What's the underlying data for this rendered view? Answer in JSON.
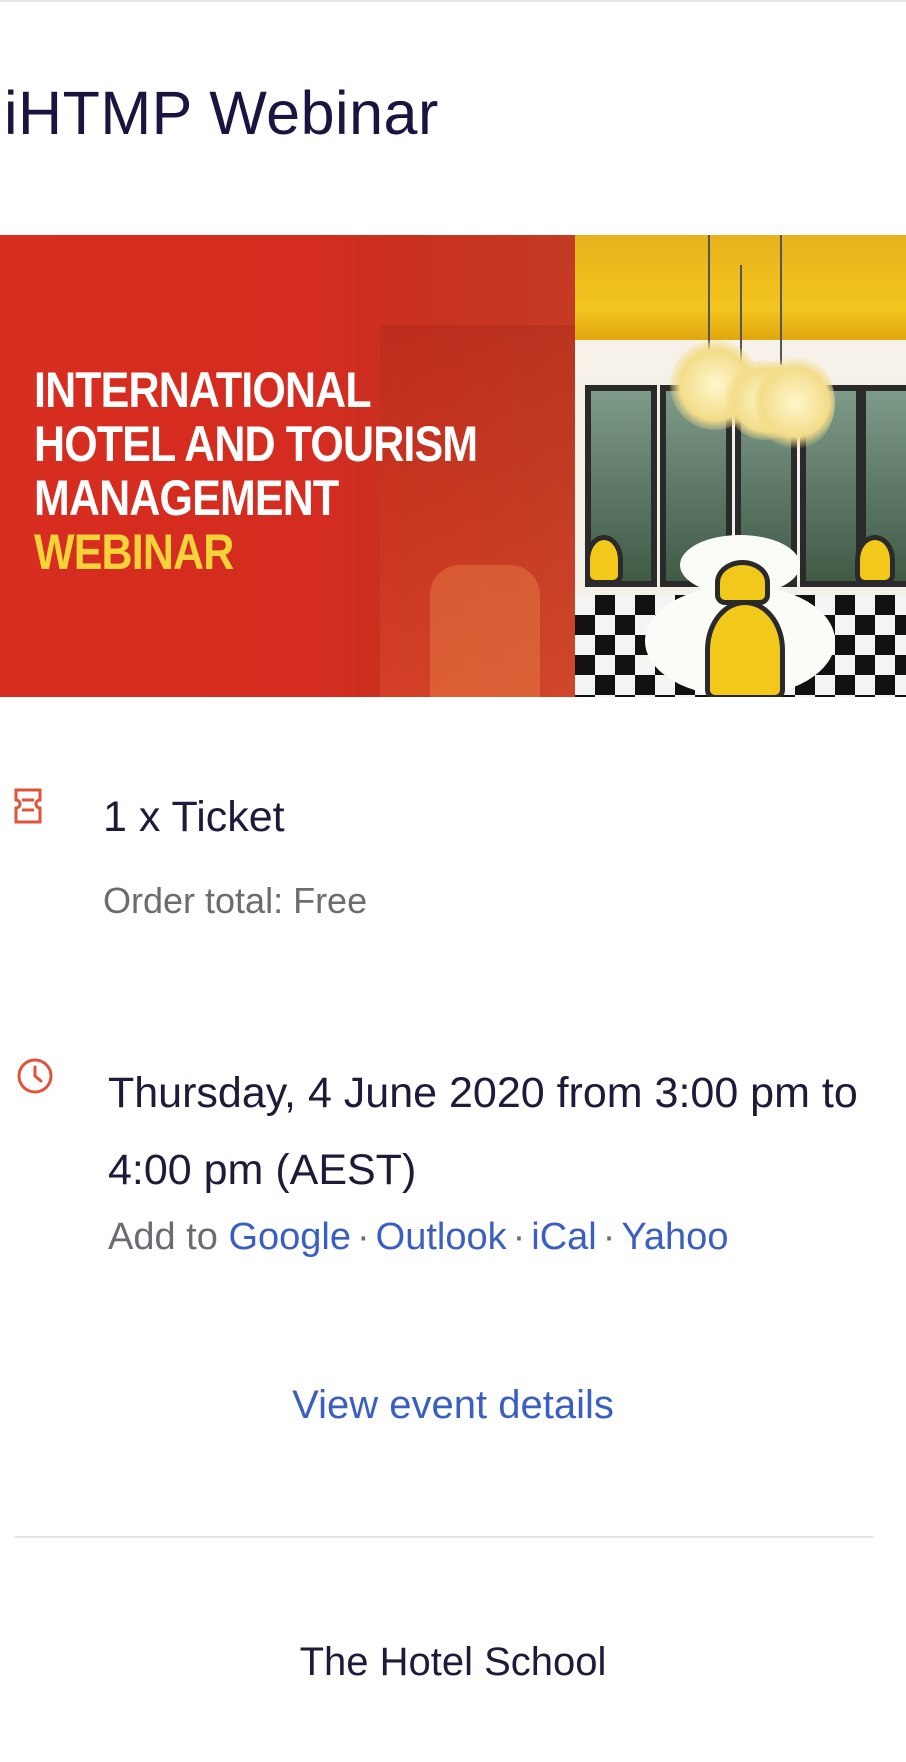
{
  "page": {
    "title": "iHTMP Webinar"
  },
  "banner": {
    "lines": [
      "INTERNATIONAL",
      "HOTEL AND TOURISM",
      "MANAGEMENT"
    ],
    "highlight": "WEBINAR",
    "colors": {
      "background": "#d82d21",
      "text": "#ffffff",
      "highlight": "#f4d23a"
    }
  },
  "ticket": {
    "icon": "ticket-icon",
    "label": "1 x Ticket",
    "order_total": "Order total: Free"
  },
  "schedule": {
    "icon": "clock-icon",
    "when": "Thursday, 4 June 2020 from 3:00 pm to 4:00 pm (AEST)",
    "add_to_label": "Add to",
    "separator": "·",
    "calendars": [
      "Google",
      "Outlook",
      "iCal",
      "Yahoo"
    ]
  },
  "view_details_label": "View event details",
  "organizer": "The Hotel School",
  "colors": {
    "accent": "#e0533a",
    "link": "#3b5fc0",
    "muted": "#6b6b72",
    "title": "#1b1440"
  }
}
